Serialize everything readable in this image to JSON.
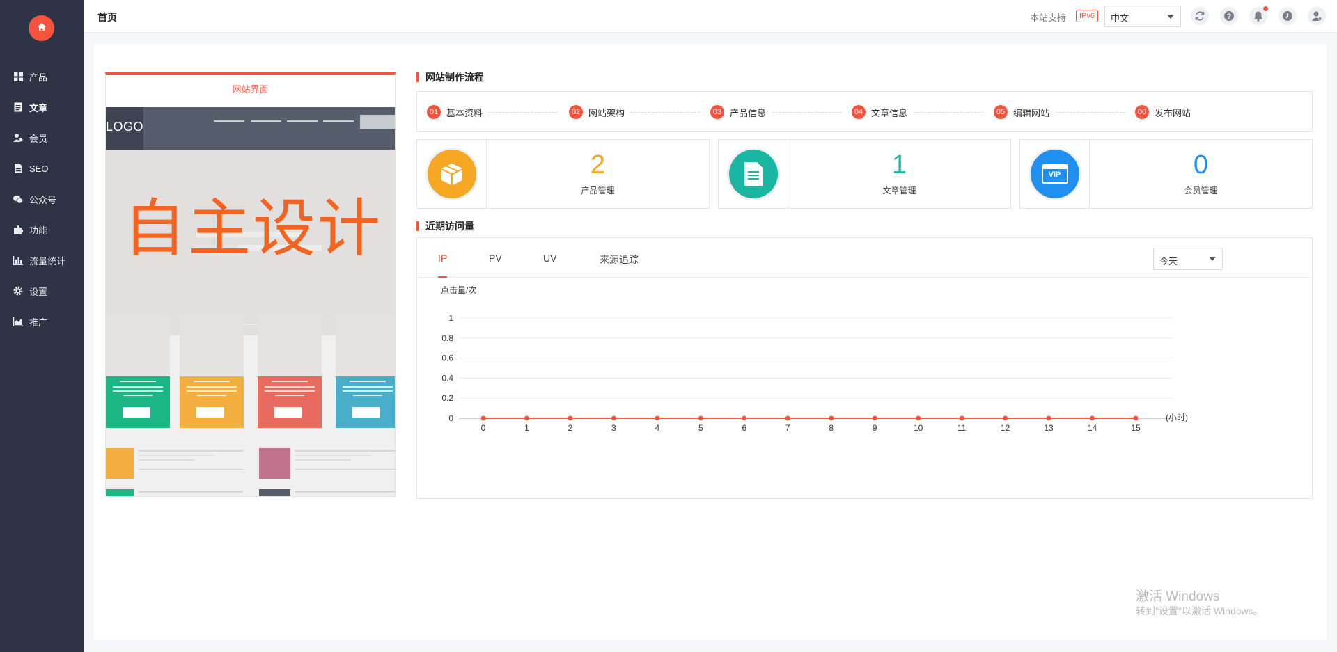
{
  "sidebar": {
    "home_icon": "home-icon",
    "items": [
      {
        "label": "产品",
        "icon": "grid-icon"
      },
      {
        "label": "文章",
        "icon": "document-icon"
      },
      {
        "label": "会员",
        "icon": "members-icon"
      },
      {
        "label": "SEO",
        "icon": "file-icon"
      },
      {
        "label": "公众号",
        "icon": "wechat-icon"
      },
      {
        "label": "功能",
        "icon": "puzzle-icon"
      },
      {
        "label": "流量统计",
        "icon": "bar-chart-icon"
      },
      {
        "label": "设置",
        "icon": "gear-icon"
      },
      {
        "label": "推广",
        "icon": "area-chart-icon"
      }
    ]
  },
  "header": {
    "title": "首页",
    "ipv6_text": "本站支持",
    "ipv6_badge": "IPv6",
    "language": "中文",
    "icons": [
      "refresh-icon",
      "help-icon",
      "bell-icon",
      "clock-icon",
      "user-icon"
    ]
  },
  "preview": {
    "title": "网站界面",
    "logo": "LOGO",
    "banner_text": "自主设计"
  },
  "process": {
    "title": "网站制作流程",
    "steps": [
      {
        "num": "01",
        "label": "基本资料"
      },
      {
        "num": "02",
        "label": "网站架构"
      },
      {
        "num": "03",
        "label": "产品信息"
      },
      {
        "num": "04",
        "label": "文章信息"
      },
      {
        "num": "05",
        "label": "编辑网站"
      },
      {
        "num": "06",
        "label": "发布网站"
      }
    ]
  },
  "stats": [
    {
      "value": "2",
      "label": "产品管理",
      "color": "#f5a623",
      "icon": "box-icon"
    },
    {
      "value": "1",
      "label": "文章管理",
      "color": "#1bb6a2",
      "icon": "doc-icon"
    },
    {
      "value": "0",
      "label": "会员管理",
      "color": "#1f8ff0",
      "icon": "vip-icon",
      "icon_text": "VIP"
    }
  ],
  "visits": {
    "title": "近期访问量",
    "tabs": [
      "IP",
      "PV",
      "UV",
      "来源追踪"
    ],
    "active_tab": "IP",
    "range": "今天"
  },
  "chart_data": {
    "type": "line",
    "ylabel": "点击量/次",
    "xlabel": "(小时)",
    "x": [
      0,
      1,
      2,
      3,
      4,
      5,
      6,
      7,
      8,
      9,
      10,
      11,
      12,
      13,
      14,
      15
    ],
    "series": [
      {
        "values": [
          0,
          0,
          0,
          0,
          0,
          0,
          0,
          0,
          0,
          0,
          0,
          0,
          0,
          0,
          0,
          0
        ],
        "color": "#f5533d"
      }
    ],
    "y_ticks": [
      "0",
      "0.2",
      "0.4",
      "0.6",
      "0.8",
      "1"
    ],
    "ylim": [
      0,
      1
    ],
    "grid": true
  },
  "watermark": {
    "line1": "激活 Windows",
    "line2": "转到\"设置\"以激活 Windows。"
  }
}
